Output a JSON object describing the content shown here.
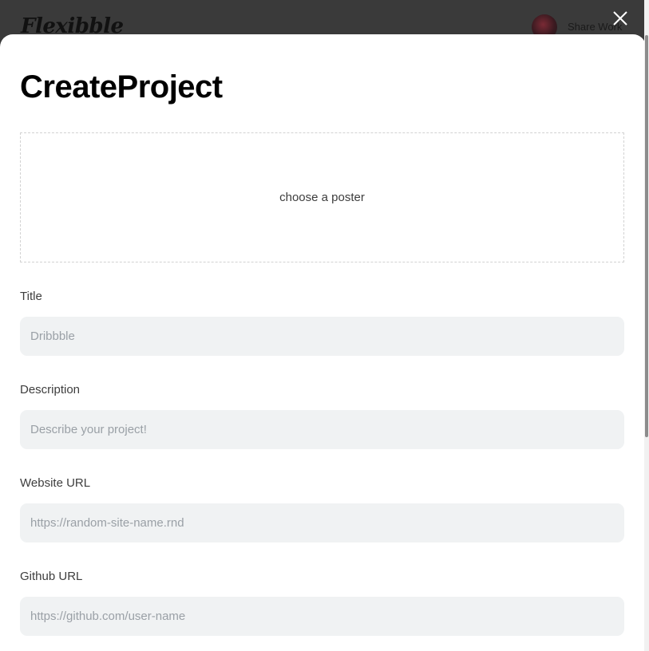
{
  "background": {
    "logo_text": "Flexibble",
    "share_label": "Share Work"
  },
  "modal": {
    "title": "CreateProject",
    "poster": {
      "label": "choose a poster"
    },
    "fields": [
      {
        "label": "Title",
        "placeholder": "Dribbble"
      },
      {
        "label": "Description",
        "placeholder": "Describe your project!"
      },
      {
        "label": "Website URL",
        "placeholder": "https://random-site-name.rnd"
      },
      {
        "label": "Github URL",
        "placeholder": "https://github.com/user-name"
      }
    ]
  },
  "icons": {
    "close": "close-icon"
  },
  "colors": {
    "input_bg": "#f0f2f3",
    "overlay": "#3a3a3a",
    "title": "#000000"
  }
}
